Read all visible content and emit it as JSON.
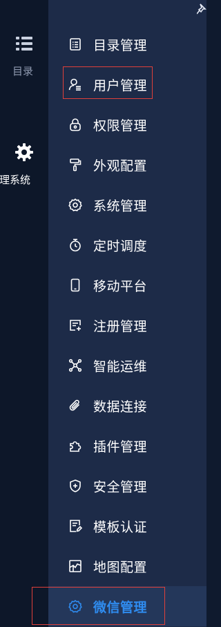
{
  "rail": {
    "catalog": {
      "label": "目录",
      "icon": "list-icon"
    },
    "admin": {
      "label": "管理系统",
      "icon": "gear-icon"
    }
  },
  "pin_icon": "pin-icon",
  "menu": {
    "items": [
      {
        "label": "目录管理",
        "icon": "catalog-icon",
        "highlighted": false,
        "active": false
      },
      {
        "label": "用户管理",
        "icon": "user-icon",
        "highlighted": true,
        "active": false
      },
      {
        "label": "权限管理",
        "icon": "lock-icon",
        "highlighted": false,
        "active": false
      },
      {
        "label": "外观配置",
        "icon": "paint-roller-icon",
        "highlighted": false,
        "active": false
      },
      {
        "label": "系统管理",
        "icon": "gear-icon",
        "highlighted": false,
        "active": false
      },
      {
        "label": "定时调度",
        "icon": "stopwatch-icon",
        "highlighted": false,
        "active": false
      },
      {
        "label": "移动平台",
        "icon": "mobile-icon",
        "highlighted": false,
        "active": false
      },
      {
        "label": "注册管理",
        "icon": "register-icon",
        "highlighted": false,
        "active": false
      },
      {
        "label": "智能运维",
        "icon": "network-icon",
        "highlighted": false,
        "active": false
      },
      {
        "label": "数据连接",
        "icon": "paperclip-icon",
        "highlighted": false,
        "active": false
      },
      {
        "label": "插件管理",
        "icon": "puzzle-icon",
        "highlighted": false,
        "active": false
      },
      {
        "label": "安全管理",
        "icon": "shield-icon",
        "highlighted": false,
        "active": false
      },
      {
        "label": "模板认证",
        "icon": "template-icon",
        "highlighted": false,
        "active": false
      },
      {
        "label": "地图配置",
        "icon": "map-icon",
        "highlighted": false,
        "active": false
      },
      {
        "label": "微信管理",
        "icon": "gear-icon",
        "highlighted": true,
        "active": true
      }
    ]
  },
  "colors": {
    "active_text": "#2f8cf0",
    "highlight_border": "#e0403a",
    "menu_bg": "#1d2b48",
    "rail_bg": "#0d1729"
  }
}
